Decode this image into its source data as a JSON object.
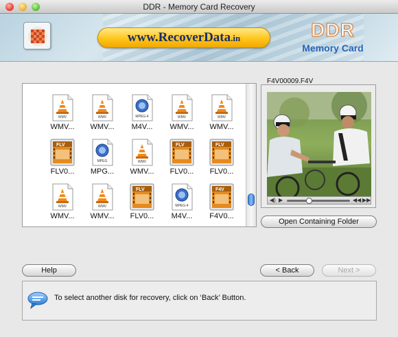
{
  "window": {
    "title": "DDR - Memory Card Recovery"
  },
  "banner": {
    "url_main": "www.RecoverData",
    "url_tld": ".in",
    "brand": "DDR",
    "product": "Memory Card"
  },
  "files": [
    {
      "label": "WMV...",
      "icon": "vlc-cone-icon",
      "type": "WMV"
    },
    {
      "label": "WMV...",
      "icon": "vlc-cone-icon",
      "type": "WMV"
    },
    {
      "label": "M4V...",
      "icon": "quicktime-icon",
      "type": "MPEG-4"
    },
    {
      "label": "WMV...",
      "icon": "vlc-cone-icon",
      "type": "WMV"
    },
    {
      "label": "WMV...",
      "icon": "vlc-cone-icon",
      "type": "WMV"
    },
    {
      "label": "FLV0...",
      "icon": "flv-film-icon",
      "type": "FLV"
    },
    {
      "label": "MPG...",
      "icon": "quicktime-mpeg-icon",
      "type": "MPEG"
    },
    {
      "label": "WMV...",
      "icon": "vlc-cone-icon",
      "type": "WMV"
    },
    {
      "label": "FLV0...",
      "icon": "flv-film-icon",
      "type": "FLV"
    },
    {
      "label": "FLV0...",
      "icon": "flv-film-icon",
      "type": "FLV"
    },
    {
      "label": "WMV...",
      "icon": "vlc-cone-icon",
      "type": "WMV"
    },
    {
      "label": "WMV...",
      "icon": "vlc-cone-icon",
      "type": "WMV"
    },
    {
      "label": "FLV0...",
      "icon": "flv-film-icon",
      "type": "FLV"
    },
    {
      "label": "M4V...",
      "icon": "quicktime-icon",
      "type": "MPEG-4"
    },
    {
      "label": "F4V0...",
      "icon": "flv-film-icon",
      "type": "F4V"
    }
  ],
  "preview": {
    "filename": "F4V00009.F4V",
    "open_folder_label": "Open Containing Folder"
  },
  "buttons": {
    "help": "Help",
    "back": "< Back",
    "next": "Next >"
  },
  "message": {
    "text": "To select another disk for recovery, click on ‘Back’ Button."
  },
  "colors": {
    "accent_blue": "#2a64b4",
    "pill_yellow": "#ffc51a",
    "brand_orange": "#d96f1c"
  }
}
